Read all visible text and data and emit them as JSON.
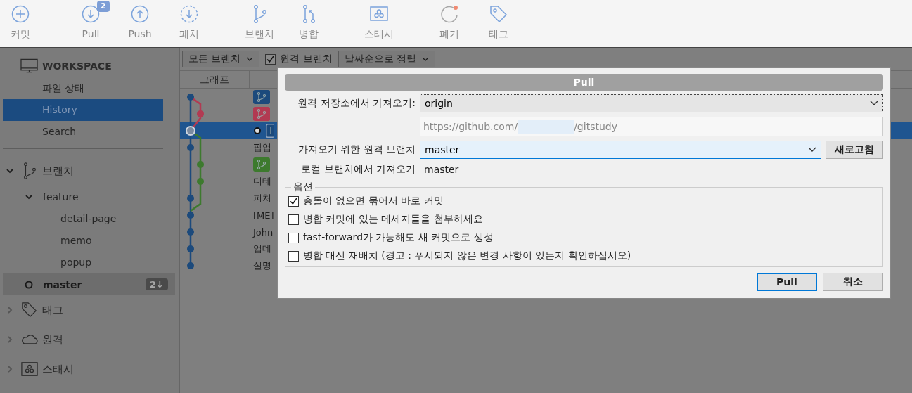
{
  "toolbar": [
    {
      "kind": "commit",
      "label": "커밋"
    },
    {
      "kind": "pull",
      "label": "Pull",
      "badge": "2"
    },
    {
      "kind": "push",
      "label": "Push"
    },
    {
      "kind": "patch",
      "label": "패치"
    },
    {
      "kind": "branch",
      "label": "브랜치"
    },
    {
      "kind": "merge",
      "label": "병합"
    },
    {
      "kind": "stash",
      "label": "스태시"
    },
    {
      "kind": "discard",
      "label": "폐기"
    },
    {
      "kind": "tag",
      "label": "태그"
    }
  ],
  "sidebar": {
    "workspace": {
      "title": "WORKSPACE",
      "items": [
        {
          "label": "파일 상태",
          "selected": false
        },
        {
          "label": "History",
          "selected": true
        },
        {
          "label": "Search",
          "selected": false
        }
      ]
    },
    "sections": [
      {
        "kind": "branch",
        "label": "브랜치",
        "expanded": true,
        "children": [
          {
            "label": "feature",
            "expanded": true,
            "children": [
              {
                "label": "detail-page",
                "current": false
              },
              {
                "label": "memo",
                "current": false
              },
              {
                "label": "popup",
                "current": false
              }
            ]
          },
          {
            "label": "master",
            "current": true,
            "badge": "2↓"
          }
        ]
      },
      {
        "kind": "tag",
        "label": "태그",
        "expanded": false
      },
      {
        "kind": "remote",
        "label": "원격",
        "expanded": false
      },
      {
        "kind": "stash",
        "label": "스태시",
        "expanded": false
      }
    ]
  },
  "filter_bar": {
    "branch_filter": "모든 브랜치",
    "remote_branches": {
      "label": "원격 브랜치",
      "checked": true
    },
    "sort": "날짜순으로 정렬"
  },
  "commits": {
    "columns": [
      "그래프"
    ],
    "rows": [
      {
        "kind": "tag",
        "color": "#1c4a7c",
        "selected": false
      },
      {
        "kind": "tag",
        "color": "#b23a52",
        "selected": false
      },
      {
        "kind": "head",
        "color": "#1c4a7c",
        "selected": true
      },
      {
        "kind": "text",
        "text": "팝업",
        "selected": false
      },
      {
        "kind": "tag",
        "color": "#3d7a2e",
        "selected": false
      },
      {
        "kind": "text",
        "text": "디테",
        "selected": false
      },
      {
        "kind": "text",
        "text": "피처",
        "selected": false
      },
      {
        "kind": "text",
        "text": "[ME]",
        "selected": false
      },
      {
        "kind": "text",
        "text": "John",
        "selected": false
      },
      {
        "kind": "text",
        "text": "업데",
        "selected": false
      },
      {
        "kind": "text",
        "text": "설명",
        "selected": false
      }
    ]
  },
  "dialog": {
    "title": "Pull",
    "remote": {
      "label": "원격 저장소에서 가져오기:",
      "value": "origin"
    },
    "url": {
      "prefix": "https://github.com/",
      "suffix": "/gitstudy"
    },
    "remote_branch": {
      "label": "가져오기 위한 원격 브랜치",
      "value": "master",
      "button": "새로고침"
    },
    "local_branch": {
      "label": "로컬 브랜치에서 가져오기",
      "value": "master"
    },
    "options": {
      "title": "옵션",
      "items": [
        {
          "label": "충돌이 없으면 묶어서 바로 커밋",
          "checked": true
        },
        {
          "label": "병합 커밋에 있는 메세지들을 첨부하세요",
          "checked": false
        },
        {
          "label": "fast-forward가 가능해도 새 커밋으로 생성",
          "checked": false
        },
        {
          "label": "병합 대신 재배치 (경고 : 푸시되지 않은 변경 사항이 있는지 확인하십시오)",
          "checked": false
        }
      ]
    },
    "buttons": [
      {
        "label": "Pull",
        "default": true
      },
      {
        "label": "취소",
        "default": false
      }
    ]
  }
}
